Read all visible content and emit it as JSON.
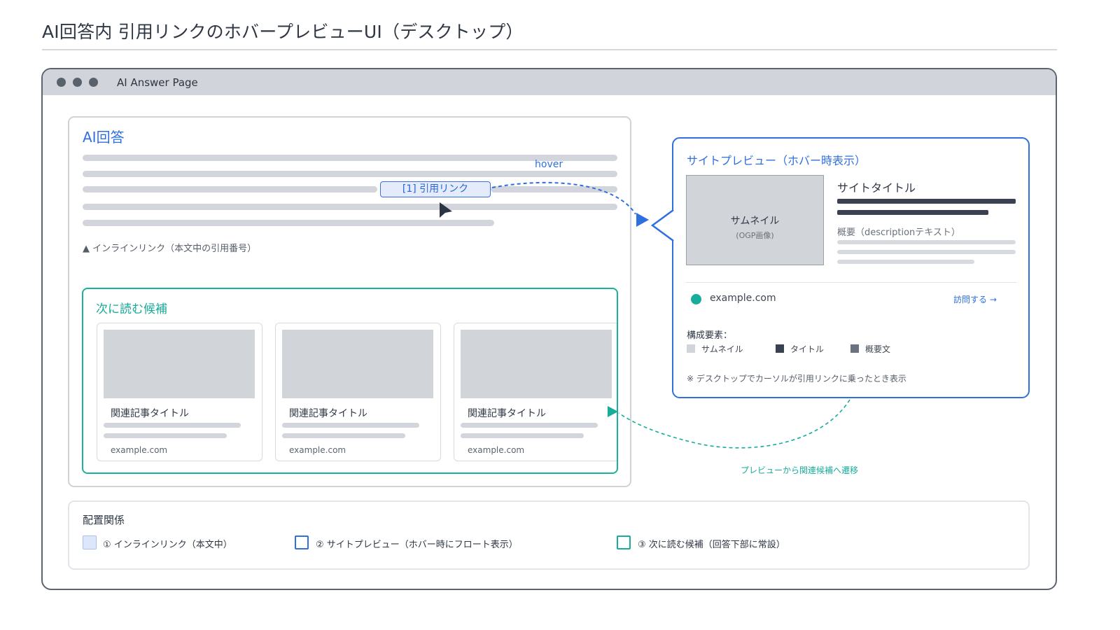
{
  "page": {
    "title": "AI回答内 引用リンクのホバープレビューUI（デスクトップ）"
  },
  "browser": {
    "title": "AI Answer Page"
  },
  "answer": {
    "heading": "AI回答",
    "citation_link": "[1] 引用リンク",
    "hover_label": "hover",
    "inline_caption": "▲ インラインリンク（本文中の引用番号）"
  },
  "next_reads": {
    "heading": "次に読む候補",
    "cards": [
      {
        "title": "関連記事タイトル",
        "domain": "example.com"
      },
      {
        "title": "関連記事タイトル",
        "domain": "example.com"
      },
      {
        "title": "関連記事タイトル",
        "domain": "example.com"
      }
    ]
  },
  "preview": {
    "heading": "サイトプレビュー（ホバー時表示）",
    "thumbnail_label": "サムネイル",
    "thumbnail_sub": "(OGP画像)",
    "site_title": "サイトタイトル",
    "description_label": "概要（descriptionテキスト）",
    "domain": "example.com",
    "visit_link": "訪問する →",
    "elements_label": "構成要素：",
    "legend": [
      {
        "label": "サムネイル",
        "color": "#d1d4d9"
      },
      {
        "label": "タイトル",
        "color": "#3a4252"
      },
      {
        "label": "概要文",
        "color": "#6b7280"
      }
    ],
    "note": "※ デスクトップでカーソルが引用リンクに乗ったとき表示"
  },
  "transition_label": "プレビューから関連候補へ遷移",
  "layout": {
    "heading": "配置関係",
    "items": [
      {
        "label": "① インラインリンク（本文中）"
      },
      {
        "label": "② サイトプレビュー（ホバー時にフロート表示）"
      },
      {
        "label": "③ 次に読む候補（回答下部に常設）"
      }
    ]
  },
  "colors": {
    "accent_blue": "#2f6fdf",
    "accent_teal": "#18ad9a",
    "placeholder_gray": "#d1d4d9",
    "dark_bar": "#3a4252"
  }
}
